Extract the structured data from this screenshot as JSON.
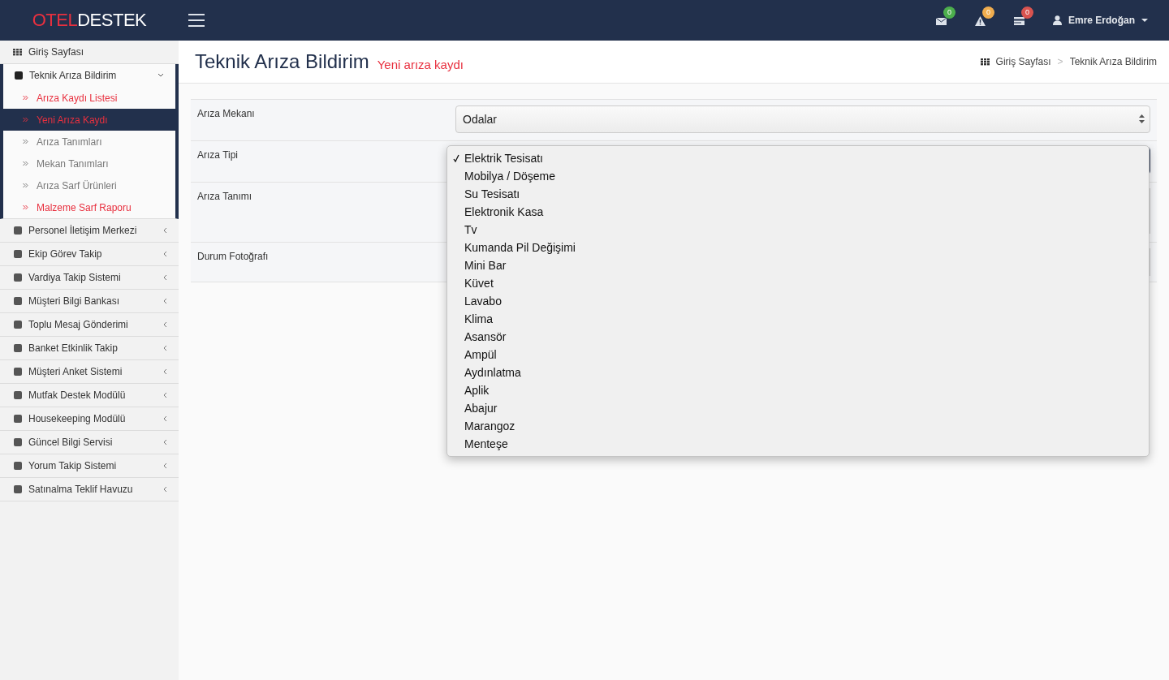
{
  "logo": {
    "prefix": "OTEL",
    "suffix": "DESTEK"
  },
  "topbar": {
    "notifications": [
      {
        "kind": "mail",
        "count": "0",
        "color": "#4cae4c"
      },
      {
        "kind": "alert",
        "count": "0",
        "color": "#f0ad4e"
      },
      {
        "kind": "card",
        "count": "0",
        "color": "#d9534f"
      }
    ],
    "user": "Emre Erdoğan"
  },
  "sidebar": {
    "home": "Giriş Sayfası",
    "groups": [
      {
        "label": "Teknik Arıza Bildirim",
        "expanded": true,
        "children": [
          {
            "label": "Arıza Kaydı Listesi",
            "highlighted": true,
            "selected": false
          },
          {
            "label": "Yeni Arıza Kaydı",
            "highlighted": true,
            "selected": true
          },
          {
            "label": "Arıza Tanımları",
            "highlighted": false,
            "selected": false
          },
          {
            "label": "Mekan Tanımları",
            "highlighted": false,
            "selected": false
          },
          {
            "label": "Arıza Sarf Ürünleri",
            "highlighted": false,
            "selected": false
          },
          {
            "label": "Malzeme Sarf Raporu",
            "highlighted": true,
            "selected": false
          }
        ]
      },
      {
        "label": "Personel İletişim Merkezi",
        "expanded": false
      },
      {
        "label": "Ekip Görev Takip",
        "expanded": false
      },
      {
        "label": "Vardiya Takip Sistemi",
        "expanded": false
      },
      {
        "label": "Müşteri Bilgi Bankası",
        "expanded": false
      },
      {
        "label": "Toplu Mesaj Gönderimi",
        "expanded": false
      },
      {
        "label": "Banket Etkinlik Takip",
        "expanded": false
      },
      {
        "label": "Müşteri Anket Sistemi",
        "expanded": false
      },
      {
        "label": "Mutfak Destek Modülü",
        "expanded": false
      },
      {
        "label": "Housekeeping Modülü",
        "expanded": false
      },
      {
        "label": "Güncel Bilgi Servisi",
        "expanded": false
      },
      {
        "label": "Yorum Takip Sistemi",
        "expanded": false
      },
      {
        "label": "Satınalma Teklif Havuzu",
        "expanded": false
      }
    ]
  },
  "page": {
    "title": "Teknik Arıza Bildirim",
    "subtitle": "Yeni arıza kaydı",
    "breadcrumb": [
      "Giriş Sayfası",
      "Teknik Arıza Bildirim"
    ],
    "breadcrumb_separator": ">"
  },
  "form": {
    "rows": [
      {
        "label": "Arıza Mekanı",
        "kind": "select",
        "value": "Odalar",
        "focused": false
      },
      {
        "label": "Arıza Tipi",
        "kind": "select",
        "value": "",
        "focused": true,
        "options": [
          {
            "label": "Elektrik Tesisatı",
            "checked": true
          },
          {
            "label": "Mobilya / Döşeme",
            "checked": false
          },
          {
            "label": "Su Tesisatı",
            "checked": false
          },
          {
            "label": "Elektronik Kasa",
            "checked": false
          },
          {
            "label": "Tv",
            "checked": false
          },
          {
            "label": "Kumanda Pil Değişimi",
            "checked": false
          },
          {
            "label": "Mini Bar",
            "checked": false
          },
          {
            "label": "Küvet",
            "checked": false
          },
          {
            "label": "Lavabo",
            "checked": false
          },
          {
            "label": "Klima",
            "checked": false
          },
          {
            "label": "Asansör",
            "checked": false
          },
          {
            "label": "Ampül",
            "checked": false
          },
          {
            "label": "Aydınlatma",
            "checked": false
          },
          {
            "label": "Aplik",
            "checked": false
          },
          {
            "label": "Abajur",
            "checked": false
          },
          {
            "label": "Marangoz",
            "checked": false
          },
          {
            "label": "Menteşe",
            "checked": false
          }
        ]
      },
      {
        "label": "Arıza Tanımı",
        "kind": "textarea"
      },
      {
        "label": "Durum Fotoğrafı",
        "kind": "file"
      }
    ]
  }
}
